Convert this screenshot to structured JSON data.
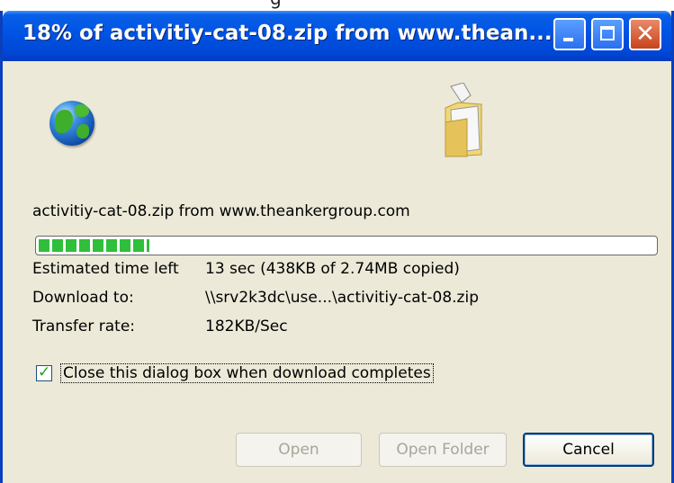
{
  "window": {
    "title": "18% of activitiy-cat-08.zip from www.thean..."
  },
  "titlebar_buttons": {
    "minimize": "minimize",
    "maximize": "maximize",
    "close": "✕"
  },
  "icons": {
    "source": "globe-icon",
    "destination": "folder-icon"
  },
  "download": {
    "file_line": "activitiy-cat-08.zip from www.theankergroup.com",
    "progress_percent": 18
  },
  "details": {
    "time_label": "Estimated time left",
    "time_value": "13 sec (438KB of 2.74MB copied)",
    "download_to_label": "Download to:",
    "download_to_value": "\\\\srv2k3dc\\use...\\activitiy-cat-08.zip",
    "rate_label": "Transfer rate:",
    "rate_value": "182KB/Sec"
  },
  "close_option": {
    "checked": true,
    "label": "Close this dialog box when download completes"
  },
  "buttons": {
    "open": "Open",
    "open_folder": "Open Folder",
    "cancel": "Cancel"
  },
  "colors": {
    "titlebar": "#0055e5",
    "progress": "#2fbf3a",
    "dialog_bg": "#ece9d8"
  }
}
